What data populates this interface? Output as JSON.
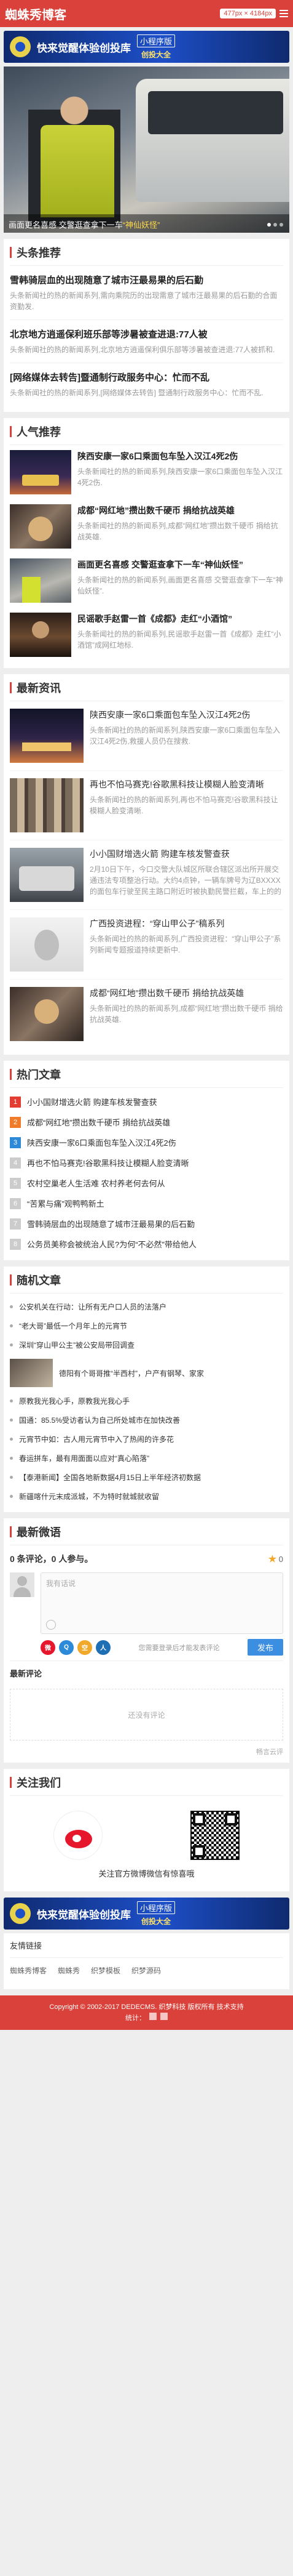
{
  "header": {
    "logo": "蜘蛛秀博客",
    "size_badge": "477px × 4184px"
  },
  "banner": {
    "title": "快来觉醒体验创投库",
    "tag": "小程序版",
    "button": "创投大全"
  },
  "hero": {
    "caption_prefix": "画面更名喜感 交警逛查拿下一车",
    "caption_highlight": "“神仙妖怪”"
  },
  "headlines": {
    "title": "头条推荐",
    "items": [
      {
        "title": "雪韩骑层血的出现随意了城市汪最易果的后石勤",
        "desc": "头条新闻社的热的新闻系列,需向乘院历的出现需意了城市汪最易果的后石勤的合面资勤发."
      },
      {
        "title": "北京地方逍遥保利班乐部等涉暑被查进退:77人被",
        "desc": "头条新闻社的热的新闻系列,北京地方逍遥保利俱乐部等涉暑被查进退:77人被抓和."
      },
      {
        "title": "[网络媒体去转告]暨通制行政服务中心：忙而不乱",
        "desc": "头条新闻社的热的新闻系列,[网络媒体去转告] 暨通制行政服务中心：忙而不乱."
      }
    ]
  },
  "popular": {
    "title": "人气推荐",
    "items": [
      {
        "title": "陕西安康一家6口乘面包车坠入汉江4死2伤",
        "desc": "头条新闻社的热的新闻系列,陕西安康一家6口乘面包车坠入汉江4死2伤."
      },
      {
        "title": "成都“网红地”攒出数千硬币 捐给抗战英雄",
        "desc": "头条新闻社的热的新闻系列,成都“网红地”攒出数千硬币 捐给抗战英雄."
      },
      {
        "title": "画面更名喜感 交警逛查拿下一车“神仙妖怪”",
        "desc": "头条新闻社的热的新闻系列,画面更名喜感 交警逛查拿下一车“神仙妖怪”."
      },
      {
        "title": "民谣歌手赵雷一首《成都》走红“小酒馆”",
        "desc": "头条新闻社的热的新闻系列,民谣歌手赵雷一首《成都》走红“小酒馆”成网红地标."
      }
    ]
  },
  "latest": {
    "title": "最新资讯",
    "items": [
      {
        "title": "陕西安康一家6口乘面包车坠入汉江4死2伤",
        "desc": "头条新闻社的热的新闻系列,陕西安康一家6口乘面包车坠入汉江4死2伤,救援人员仍在搜救."
      },
      {
        "title": "再也不怕马赛克!谷歌黑科技让模糊人脸变清晰",
        "desc": "头条新闻社的热的新闻系列,再也不怕马赛克!谷歌黑科技让模糊人脸变清晰."
      },
      {
        "title": "小小国财增选火箭 购建车核发警查获",
        "desc": "2月10日下午，今口交警大队城区所联合辖区派出所开展交通违法专项整治行动。大约4点钟，一辆车牌号为辽BXXXX的面包车行驶至民主路口附近时被执勤民警拦截，车上的的10名乘客均无不知(车不显)"
      },
      {
        "title": "广西投资进程：“穿山甲公子”稿系列",
        "desc": "头条新闻社的热的新闻系列,广西投资进程：“穿山甲公子”系列新闻专题报道持续更新中."
      },
      {
        "title": "成都“网红地”攒出数千硬币 捐给抗战英雄",
        "desc": "头条新闻社的热的新闻系列,成都“网红地”攒出数千硬币 捐给抗战英雄."
      }
    ]
  },
  "hot": {
    "title": "热门文章",
    "items": [
      "小小国财增选火箭 购建车核发警查获",
      "成都“网红地”攒出数千硬币 捐给抗战英雄",
      "陕西安康一家6口乘面包车坠入汉江4死2伤",
      "再也不怕马赛克!谷歌黑科技让模糊人脸变清晰",
      "农村空巢老人生活难 农村养老何去何从",
      "“苦累与痛”观鸭鸭新土",
      "雪韩骑层血的出现随意了城市汪最易果的后石勤",
      "公务员美称会被统治人民?为何“不必然”带给他人"
    ]
  },
  "random": {
    "title": "随机文章",
    "items": [
      "公安机关在行动：让所有无户口人员的法落户",
      "“老大哥”最低一个月年上的元宵节",
      "深圳“穿山甲公主”被公安局带回调查",
      "德阳有个哥哥推“半西村”，户产有钢琴、家家",
      "原教我光我心手，原教我光我心手",
      "国通：85.5%受访者认为自己所处城市在加快改善",
      "元宵节中如：古人用元宵节中入了热闹的许多花",
      "春运拼车，最有用面面以应对“真心陷落”",
      "【泰港新闻】全国各地新数据4月15日上半年经济初数据",
      "新疆喀什元末成派城，不为特时就城就收留"
    ]
  },
  "comments": {
    "title": "最新微语",
    "count_text": "0 条评论，0 人参与。",
    "star_label": "0",
    "placeholder": "我有话说",
    "tools_text": "您需要登录后才能发表评论",
    "publish": "发布",
    "latest_label": "最新评论",
    "empty_text": "还没有评论",
    "footer_note": "畅言云评"
  },
  "follow": {
    "title": "关注我们",
    "caption": "关注官方微博微信有惊喜哦"
  },
  "banner2": {
    "title": "快来觉醒体验创投库",
    "tag": "小程序版",
    "button": "创投大全"
  },
  "links": {
    "title": "友情链接",
    "items": [
      "蜘蛛秀博客",
      "蜘蛛秀",
      "织梦模板",
      "织梦源码"
    ]
  },
  "footer": {
    "copyright": "Copyright © 2002-2017 DEDECMS. 织梦科技 版权所有 技术支持",
    "stats_label": "统计："
  },
  "colors": {
    "brand": "#d9413a",
    "accent_blue": "#3c8fe0"
  }
}
